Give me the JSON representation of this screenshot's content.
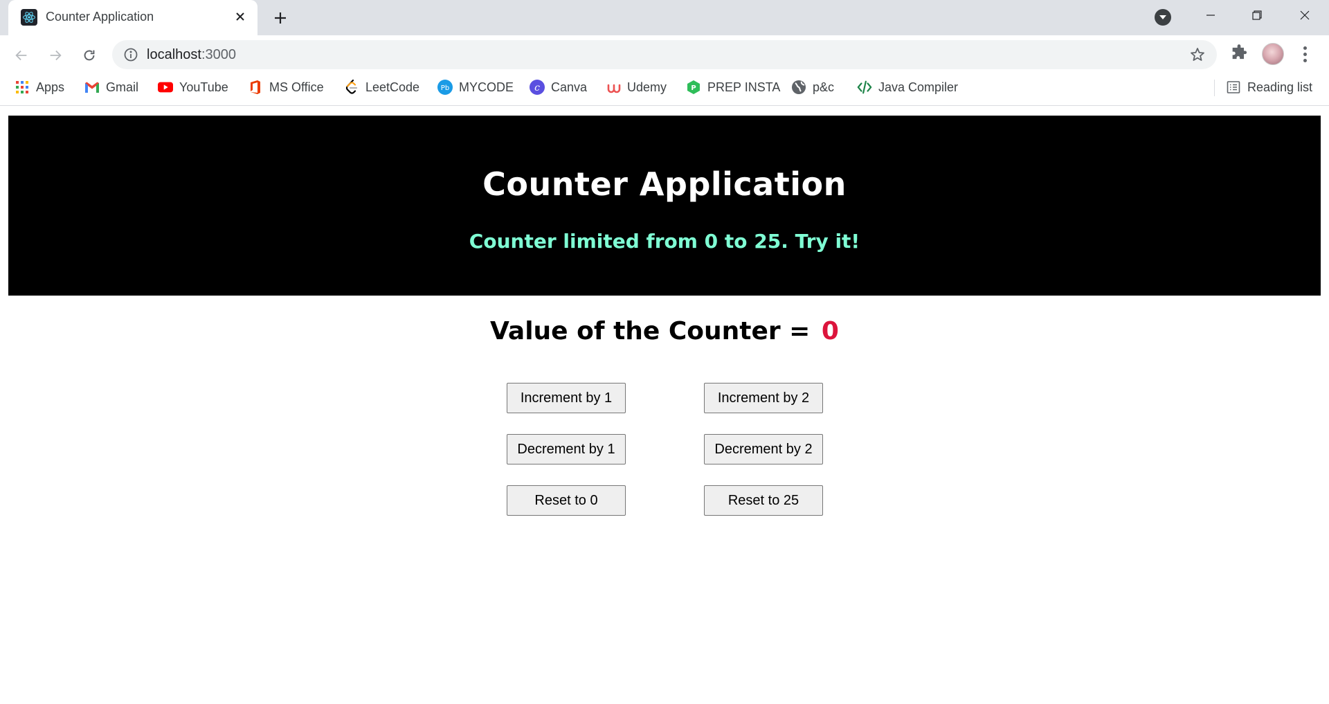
{
  "browser": {
    "tab": {
      "title": "Counter Application",
      "favicon": "react-icon"
    },
    "new_tab_label": "+",
    "address": {
      "host": "localhost",
      "port": ":3000"
    },
    "bookmarks": [
      {
        "label": "Apps",
        "icon": "apps-grid-icon"
      },
      {
        "label": "Gmail",
        "icon": "gmail-icon"
      },
      {
        "label": "YouTube",
        "icon": "youtube-icon"
      },
      {
        "label": "MS Office",
        "icon": "office-icon"
      },
      {
        "label": "LeetCode",
        "icon": "leetcode-icon"
      },
      {
        "label": "MYCODE",
        "icon": "mycode-icon"
      },
      {
        "label": "Canva",
        "icon": "canva-icon"
      },
      {
        "label": "Udemy",
        "icon": "udemy-icon"
      },
      {
        "label": "PREP INSTA",
        "icon": "prepinsta-icon"
      },
      {
        "label": "p&c",
        "icon": "globe-icon"
      },
      {
        "label": "Java Compiler",
        "icon": "code-icon"
      }
    ],
    "reading_list": "Reading list"
  },
  "app": {
    "title": "Counter Application",
    "subtitle": "Counter limited from 0 to 25. Try it!",
    "value_label": "Value of the Counter =",
    "value": "0",
    "buttons": {
      "inc1": "Increment by 1",
      "inc2": "Increment by 2",
      "dec1": "Decrement by 1",
      "dec2": "Decrement by 2",
      "reset0": "Reset to 0",
      "reset25": "Reset to 25"
    }
  },
  "colors": {
    "hero_bg": "#000000",
    "subtitle": "#7fffd4",
    "counter_value": "#dc143c",
    "tabstrip": "#dee1e6"
  }
}
